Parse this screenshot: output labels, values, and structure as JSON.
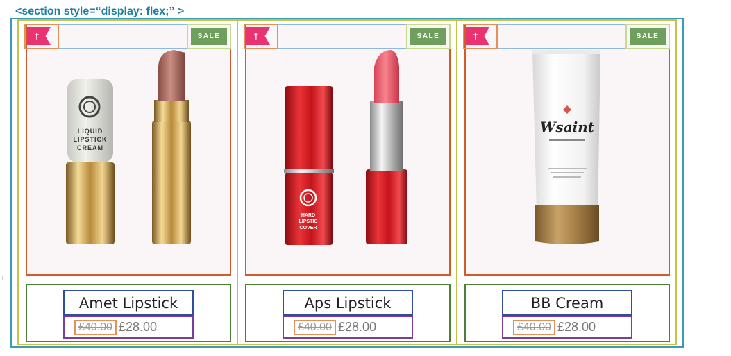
{
  "annotation": {
    "section_label": "<section style=“display: flex;” >",
    "side_marker": "+"
  },
  "products": [
    {
      "title": "Amet Lipstick",
      "badge": "SALE",
      "old_price": "£40.00",
      "new_price": "£28.00",
      "image": "liquid-lipstick-cream-image",
      "image_text": [
        "LIQUID",
        "LIPSTICK",
        "CREAM"
      ]
    },
    {
      "title": "Aps Lipstick",
      "badge": "SALE",
      "old_price": "£40.00",
      "new_price": "£28.00",
      "image": "hard-lipstick-cover-image",
      "image_text": [
        "HARD",
        "LIPSTIC",
        "COVER"
      ]
    },
    {
      "title": "BB Cream",
      "badge": "SALE",
      "old_price": "£40.00",
      "new_price": "£28.00",
      "image": "wsaint-cream-tube-image",
      "image_text": [
        "Wsaint"
      ]
    }
  ],
  "icons": {
    "pin": "pushpin-icon"
  },
  "colors": {
    "pin_flag": "#ea3270",
    "sale_badge": "#6e9f5d",
    "image_bg": "#faf5f6"
  }
}
